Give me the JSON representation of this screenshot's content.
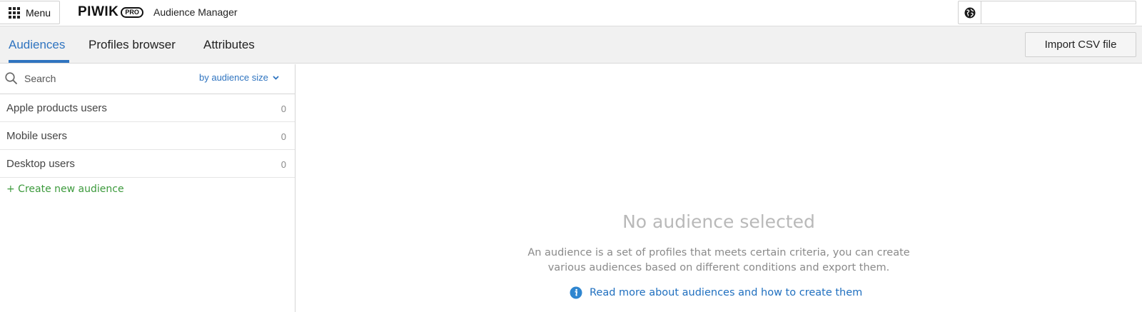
{
  "topbar": {
    "menu_label": "Menu",
    "logo_word": "PIWIK",
    "logo_badge": "PRO",
    "product_name": "Audience Manager",
    "user_field_value": ""
  },
  "tabs": [
    {
      "label": "Audiences",
      "active": true
    },
    {
      "label": "Profiles browser",
      "active": false
    },
    {
      "label": "Attributes",
      "active": false
    }
  ],
  "toolbar": {
    "import_label": "Import CSV file"
  },
  "sidebar": {
    "search_placeholder": "Search",
    "sort_label": "by audience size",
    "audiences": [
      {
        "name": "Apple products users",
        "count": "0"
      },
      {
        "name": "Mobile users",
        "count": "0"
      },
      {
        "name": "Desktop users",
        "count": "0"
      }
    ],
    "create_label": "+ Create new audience"
  },
  "empty_state": {
    "title": "No audience selected",
    "description_line1": "An audience is a set of profiles that meets certain criteria, you can create",
    "description_line2": "various audiences based on different conditions and export them.",
    "link_label": "Read more about audiences and how to create them"
  },
  "colors": {
    "accent": "#2f74c0",
    "create_green": "#3c9a3c",
    "link_blue": "#1f6fbf"
  },
  "icons": [
    "grid-icon",
    "globe-icon",
    "search-icon",
    "chevron-down-icon",
    "info-icon"
  ]
}
